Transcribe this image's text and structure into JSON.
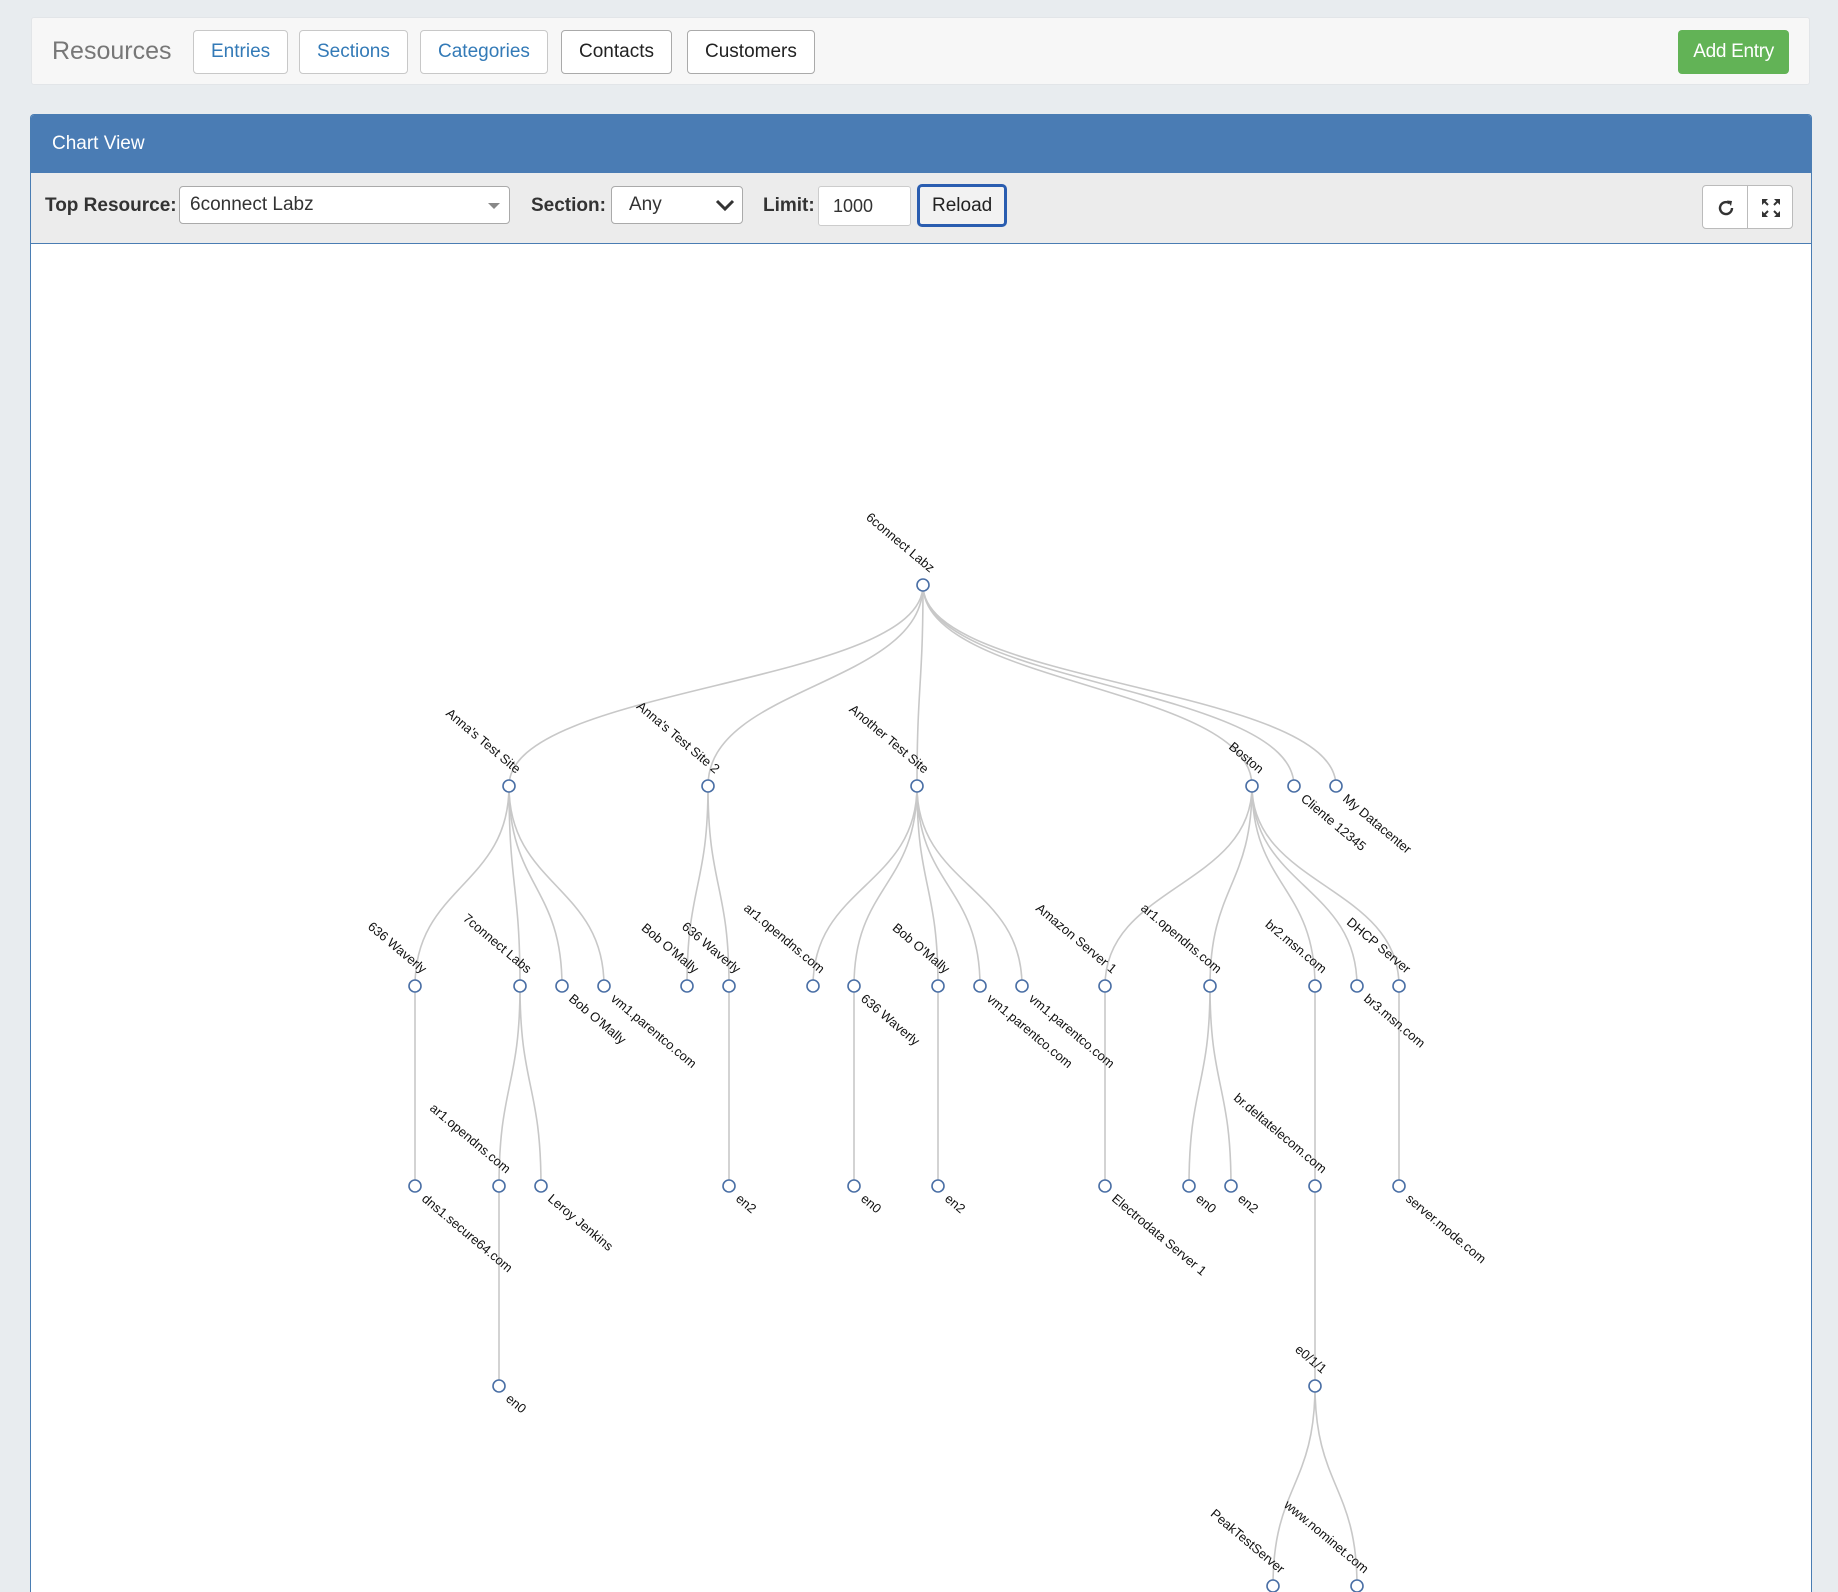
{
  "header": {
    "brand": "Resources",
    "nav": [
      "Entries",
      "Sections",
      "Categories",
      "Contacts",
      "Customers"
    ],
    "add_entry": "Add Entry"
  },
  "panel": {
    "title": "Chart View",
    "top_resource_label": "Top Resource:",
    "top_resource_value": "6connect Labz",
    "section_label": "Section:",
    "section_value": "Any",
    "limit_label": "Limit:",
    "limit_value": "1000",
    "reload_label": "Reload"
  },
  "icons": {
    "refresh": "refresh-icon",
    "fullscreen": "expand-icon"
  },
  "colors": {
    "panel_header": "#4a7cb4",
    "add_button": "#62b356",
    "node_stroke": "#4a6fa5",
    "link": "#c8c8c8"
  },
  "tree": {
    "root": "6connect Labz",
    "children": [
      {
        "label": "Anna's Test Site",
        "children": [
          {
            "label": "636 Waverly",
            "children": [
              {
                "label": "dns1.secure64.com"
              }
            ]
          },
          {
            "label": "7connect Labs",
            "children": [
              {
                "label": "ar1.opendns.com",
                "children": [
                  {
                    "label": "en0"
                  }
                ]
              },
              {
                "label": "Leroy Jenkins"
              }
            ]
          },
          {
            "label": "Bob O'Mally"
          },
          {
            "label": "vm1.parentco.com"
          }
        ]
      },
      {
        "label": "Anna's Test Site 2",
        "children": [
          {
            "label": "Bob O'Mally"
          },
          {
            "label": "636 Waverly",
            "children": [
              {
                "label": "en2"
              }
            ]
          }
        ]
      },
      {
        "label": "Another Test Site",
        "children": [
          {
            "label": "ar1.opendns.com"
          },
          {
            "label": "636 Waverly",
            "children": [
              {
                "label": "en0"
              }
            ]
          },
          {
            "label": "Bob O'Mally",
            "children": [
              {
                "label": "en2"
              }
            ]
          },
          {
            "label": "vm1.parentco.com"
          },
          {
            "label": "vm1.parentco.com"
          }
        ]
      },
      {
        "label": "Boston",
        "children": [
          {
            "label": "Amazon Server 1",
            "children": [
              {
                "label": "Electrodata Server 1"
              }
            ]
          },
          {
            "label": "ar1.opendns.com",
            "children": [
              {
                "label": "en0"
              },
              {
                "label": "en2"
              }
            ]
          },
          {
            "label": "br2.msn.com",
            "children": [
              {
                "label": "br.deltatelecom.com",
                "children": [
                  {
                    "label": "e0/1/1",
                    "children": [
                      {
                        "label": "PeakTestServer"
                      },
                      {
                        "label": "www.nominet.com"
                      }
                    ]
                  }
                ]
              }
            ]
          },
          {
            "label": "br3.msn.com"
          },
          {
            "label": "DHCP Server",
            "children": [
              {
                "label": "server.mode.com"
              }
            ]
          }
        ]
      },
      {
        "label": "Cliente 12345"
      },
      {
        "label": "My Datacenter"
      }
    ]
  }
}
